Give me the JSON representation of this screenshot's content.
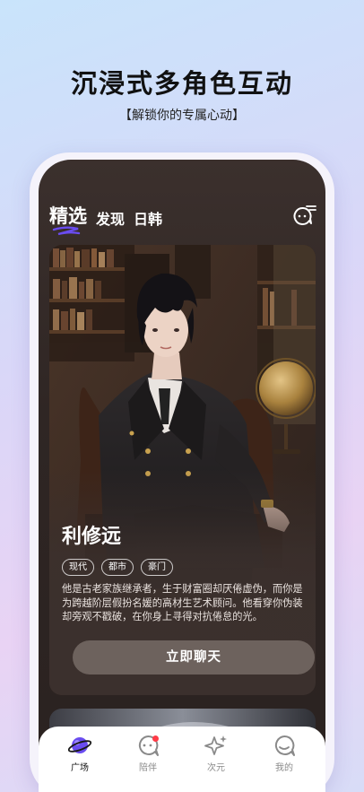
{
  "promo": {
    "headline": "沉浸式多角色互动",
    "subline": "【解锁你的专属心动】"
  },
  "header": {
    "tabs": [
      {
        "label": "精选",
        "active": true
      },
      {
        "label": "发现",
        "active": false
      },
      {
        "label": "日韩",
        "active": false
      }
    ],
    "menu_icon": "chat-list-icon"
  },
  "character_card": {
    "name": "利修远",
    "tags": [
      "现代",
      "都市",
      "豪门"
    ],
    "description": "他是古老家族继承者，生于财富圈却厌倦虚伪，而你是为跨越阶层假扮名媛的高材生艺术顾问。他看穿你伪装却旁观不戳破，在你身上寻得对抗倦怠的光。",
    "chat_button": "立即聊天"
  },
  "bottom_nav": {
    "items": [
      {
        "label": "广场",
        "icon": "planet-icon",
        "active": true
      },
      {
        "label": "陪伴",
        "icon": "chat-bubble-icon",
        "active": false,
        "badge": true
      },
      {
        "label": "次元",
        "icon": "sparkle-icon",
        "active": false
      },
      {
        "label": "我的",
        "icon": "face-icon",
        "active": false
      }
    ]
  },
  "colors": {
    "accent": "#6a4cf0",
    "badge": "#ff3b47",
    "card_bg": "#3b302d",
    "button_bg": "#6d625d"
  }
}
